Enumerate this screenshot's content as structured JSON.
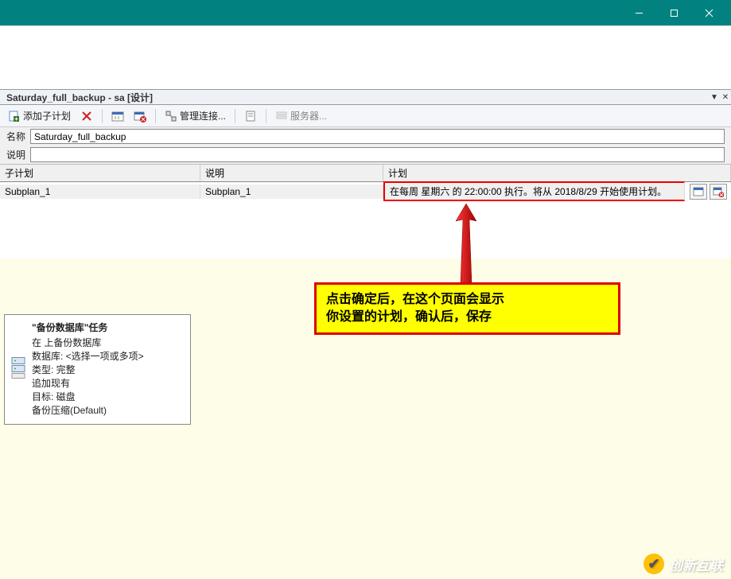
{
  "window": {
    "tab_title": "Saturday_full_backup - sa [设计]"
  },
  "toolbar": {
    "add_subplan": "添加子计划",
    "manage_connections": "管理连接...",
    "servers": "服务器..."
  },
  "form": {
    "name_label": "名称",
    "name_value": "Saturday_full_backup",
    "desc_label": "说明",
    "desc_value": ""
  },
  "grid": {
    "headers": {
      "subplan": "子计划",
      "desc": "说明",
      "plan": "计划"
    },
    "row": {
      "subplan": "Subplan_1",
      "desc": "Subplan_1",
      "plan": "在每周 星期六 的 22:00:00 执行。将从 2018/8/29 开始使用计划。"
    }
  },
  "taskbox": {
    "title": "\"备份数据库\"任务",
    "lines": [
      "在 上备份数据库",
      "数据库: <选择一项或多项>",
      "类型: 完整",
      "追加现有",
      "目标: 磁盘",
      "备份压缩(Default)"
    ]
  },
  "callout": {
    "line1": "点击确定后，在这个页面会显示",
    "line2": "你设置的计划，确认后，保存"
  },
  "watermark": "创新互联"
}
